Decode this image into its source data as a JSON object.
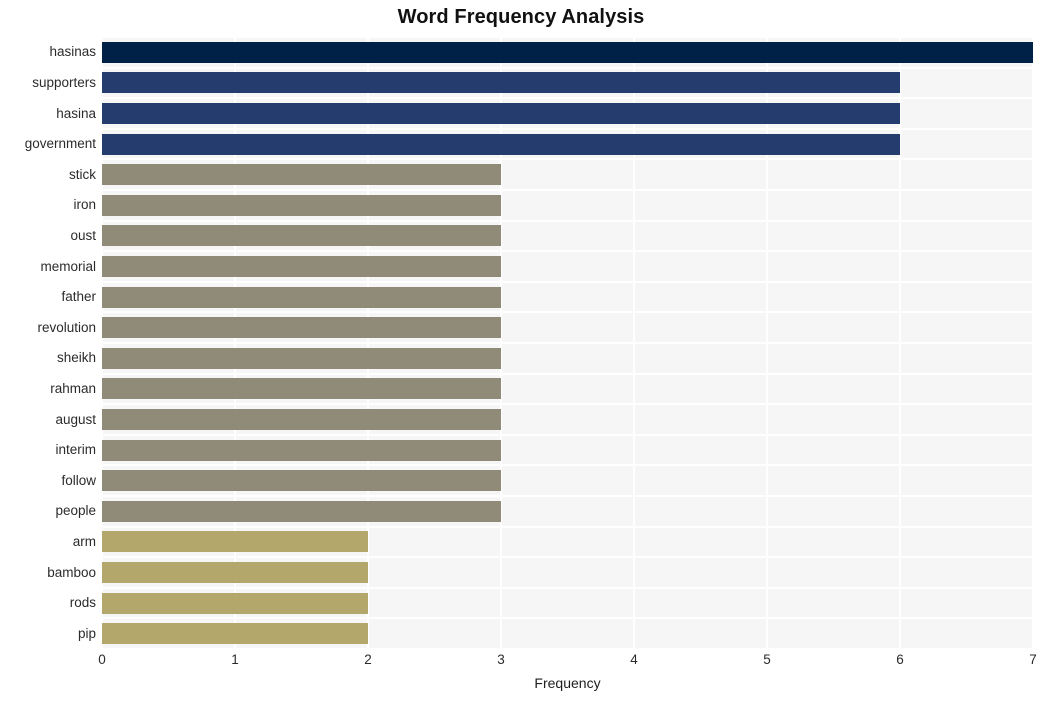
{
  "chart_data": {
    "type": "bar",
    "orientation": "horizontal",
    "title": "Word Frequency Analysis",
    "xlabel": "Frequency",
    "ylabel": "",
    "xlim": [
      0,
      7
    ],
    "ylim": [
      0,
      20
    ],
    "grid": true,
    "legend": null,
    "xticks": [
      "0",
      "1",
      "2",
      "3",
      "4",
      "5",
      "6",
      "7"
    ],
    "xtick_values": [
      0,
      1,
      2,
      3,
      4,
      5,
      6,
      7
    ],
    "categories": [
      "hasinas",
      "supporters",
      "hasina",
      "government",
      "stick",
      "iron",
      "oust",
      "memorial",
      "father",
      "revolution",
      "sheikh",
      "rahman",
      "august",
      "interim",
      "follow",
      "people",
      "arm",
      "bamboo",
      "rods",
      "pip"
    ],
    "values": [
      7,
      6,
      6,
      6,
      3,
      3,
      3,
      3,
      3,
      3,
      3,
      3,
      3,
      3,
      3,
      3,
      2,
      2,
      2,
      2
    ],
    "bar_colors": [
      "#002147",
      "#243c6e",
      "#243c6e",
      "#243c6e",
      "#908a79",
      "#908a79",
      "#908a79",
      "#908a79",
      "#908a79",
      "#908a79",
      "#908a79",
      "#908a79",
      "#908a79",
      "#908a79",
      "#908a79",
      "#908a79",
      "#b3a76b",
      "#b3a76b",
      "#b3a76b",
      "#b3a76b"
    ]
  },
  "style": {
    "plot_background": "#f6f6f7",
    "figure_background": "#ffffff",
    "gridline_color": "#ffffff",
    "title_color": "#111111",
    "tick_color": "#2b2b2b"
  }
}
